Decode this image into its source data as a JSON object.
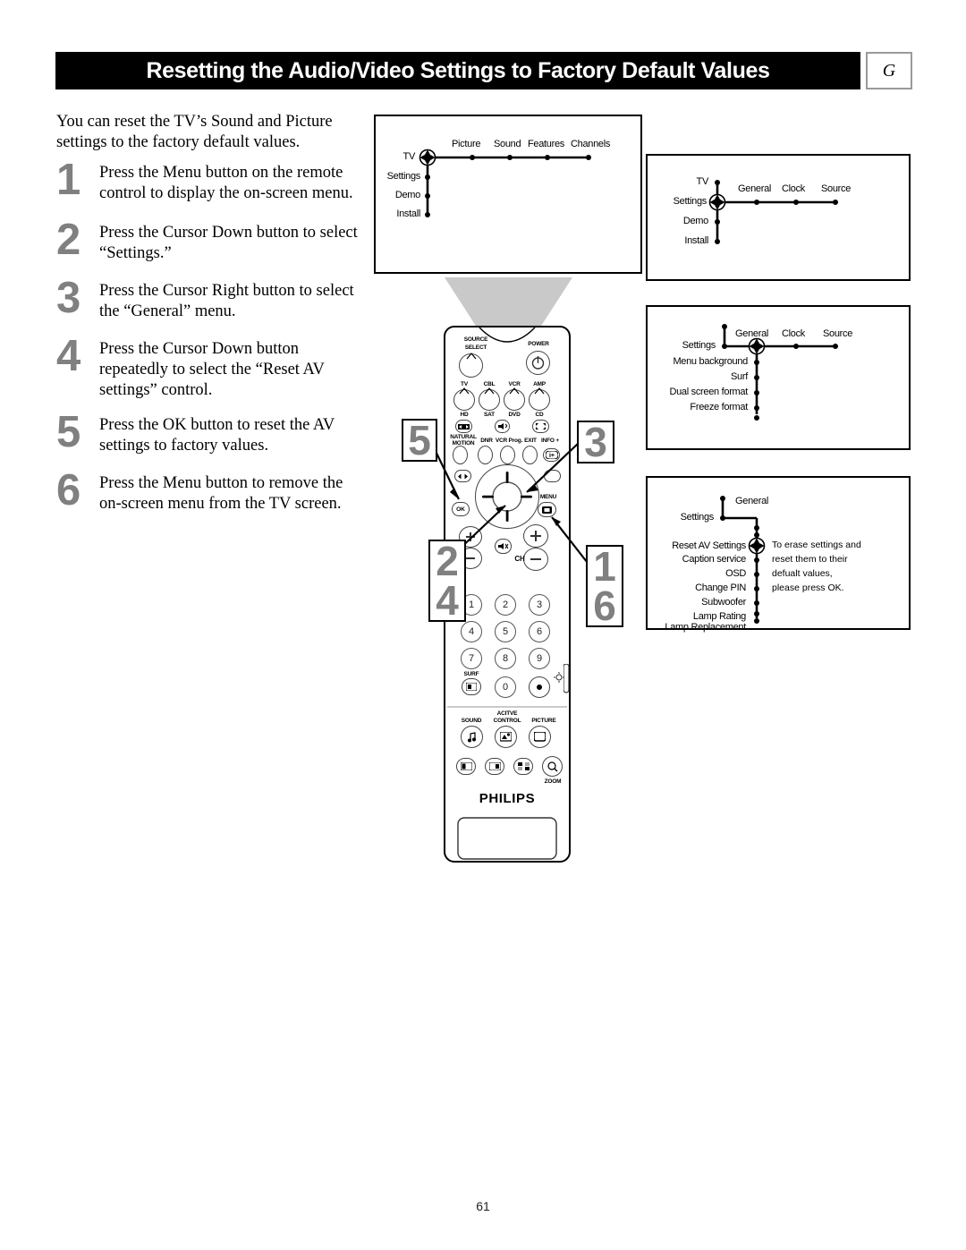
{
  "header": {
    "title": "Resetting the Audio/Video Settings to Factory Default Values",
    "section_tab": "G"
  },
  "intro": "You can reset the TV’s Sound and Picture settings to the factory default values.",
  "steps": [
    {
      "number": "1",
      "text": "Press the Menu button on the remote control to display the on-screen menu."
    },
    {
      "number": "2",
      "text": "Press the Cursor Down button to select “Settings.”"
    },
    {
      "number": "3",
      "text": "Press the Cursor Right button to select the “General” menu."
    },
    {
      "number": "4",
      "text": "Press the Cursor Down button repeatedly to select the “Reset AV settings” control."
    },
    {
      "number": "5",
      "text": "Press the OK button to reset the AV settings to factory values."
    },
    {
      "number": "6",
      "text": "Press the Menu button to remove the on-screen menu from the TV screen."
    }
  ],
  "menus": {
    "main": {
      "root": "TV",
      "vertical": [
        "Settings",
        "Demo",
        "Install"
      ],
      "horizontal": [
        "Picture",
        "Sound",
        "Features",
        "Channels"
      ]
    },
    "settings": {
      "above": "TV",
      "selected": "Settings",
      "vertical_below": [
        "Demo",
        "Install"
      ],
      "horizontal": [
        "General",
        "Clock",
        "Source"
      ]
    },
    "general": {
      "left": "Settings",
      "selected": "General",
      "horizontal": [
        "Clock",
        "Source"
      ],
      "vertical": [
        "Menu background",
        "Surf",
        "Dual screen format",
        "Freeze format"
      ]
    },
    "reset": {
      "left": "Settings",
      "parent": "General",
      "selected": "Reset AV Settings",
      "vertical": [
        "Caption service",
        "OSD",
        "Change PIN",
        "Subwoofer",
        "Lamp Rating",
        "Lamp Replacement"
      ],
      "help_lines": [
        "To erase settings and",
        "reset them to their",
        "defualt values,",
        "please press OK."
      ]
    }
  },
  "remote": {
    "brand": "PHILIPS",
    "labels": {
      "source_select_1": "SOURCE",
      "source_select_2": "SELECT",
      "power": "POWER",
      "tv": "TV",
      "cbl": "CBL",
      "vcr": "VCR",
      "amp": "AMP",
      "hd": "HD",
      "sat": "SAT",
      "dvd": "DVD",
      "cd": "CD",
      "natural_1": "NATURAL",
      "natural_2": "MOTION",
      "dnr": "DNR",
      "vcr_prog": "VCR Prog.",
      "exit": "EXIT",
      "info": "INFO +",
      "ok": "OK",
      "menu": "MENU",
      "ch": "CH",
      "surf": "SURF",
      "active": "ACITVE",
      "sound": "SOUND",
      "control": "CONTROL",
      "picture": "PICTURE",
      "zoom": "ZOOM"
    },
    "keypad": [
      "1",
      "2",
      "3",
      "4",
      "5",
      "6",
      "7",
      "8",
      "9",
      "0"
    ]
  },
  "callouts": {
    "left_top": [
      "5"
    ],
    "left_bottom": [
      "2",
      "4"
    ],
    "right_top": [
      "3"
    ],
    "right_bottom": [
      "1",
      "6"
    ]
  },
  "page_number": "61",
  "colors": {
    "accent_gray": "#808080",
    "title_bar": "#000000",
    "beam": "#c9c9c9"
  }
}
